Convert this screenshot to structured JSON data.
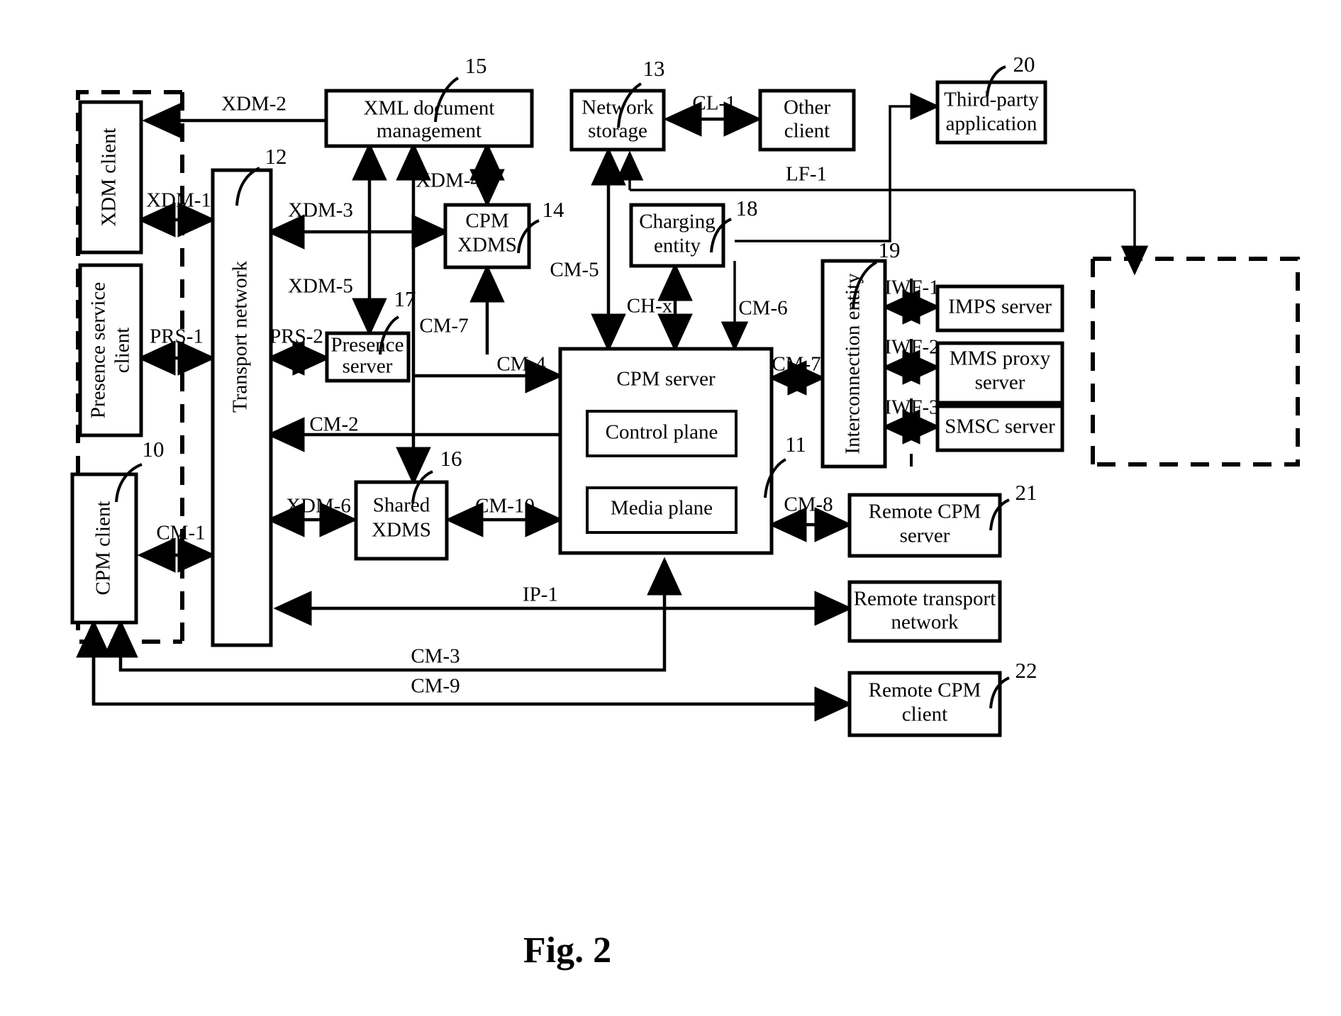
{
  "figure": {
    "caption": "Fig. 2"
  },
  "boxes": [
    {
      "id": "xdm-client",
      "label": "XDM client",
      "orientation": "vertical"
    },
    {
      "id": "presence-service-client",
      "label": "Presence service client",
      "orientation": "vertical"
    },
    {
      "id": "cpm-client",
      "label": "CPM client",
      "orientation": "vertical"
    },
    {
      "id": "transport-network",
      "label": "Transport network",
      "orientation": "vertical"
    },
    {
      "id": "xml-document-management",
      "label": "XML document management",
      "orientation": "horizontal"
    },
    {
      "id": "cpm-xdms",
      "label": "CPM XDMS",
      "orientation": "horizontal"
    },
    {
      "id": "presence-server",
      "label": "Presence server",
      "orientation": "horizontal"
    },
    {
      "id": "shared-xdms",
      "label": "Shared XDMS",
      "orientation": "horizontal"
    },
    {
      "id": "network-storage",
      "label": "Network storage",
      "orientation": "horizontal"
    },
    {
      "id": "other-client",
      "label": "Other client",
      "orientation": "horizontal"
    },
    {
      "id": "third-party-application",
      "label": "Third-party application",
      "orientation": "horizontal"
    },
    {
      "id": "charging-entity",
      "label": "Charging entity",
      "orientation": "horizontal"
    },
    {
      "id": "cpm-server",
      "label": "CPM server",
      "orientation": "horizontal"
    },
    {
      "id": "control-plane",
      "label": "Control plane",
      "orientation": "horizontal"
    },
    {
      "id": "media-plane",
      "label": "Media plane",
      "orientation": "horizontal"
    },
    {
      "id": "interconnection-entity",
      "label": "Interconnection entity",
      "orientation": "vertical"
    },
    {
      "id": "imps-server",
      "label": "IMPS server",
      "orientation": "horizontal"
    },
    {
      "id": "mms-proxy-server",
      "label": "MMS proxy server",
      "orientation": "horizontal"
    },
    {
      "id": "smsc-server",
      "label": "SMSC server",
      "orientation": "horizontal"
    },
    {
      "id": "remote-cpm-server",
      "label": "Remote CPM server",
      "orientation": "horizontal"
    },
    {
      "id": "remote-transport-network",
      "label": "Remote transport network",
      "orientation": "horizontal"
    },
    {
      "id": "remote-cpm-client",
      "label": "Remote CPM client",
      "orientation": "horizontal"
    }
  ],
  "box_labels": {
    "xdm_client": "XDM client",
    "presence_service_client_line1": "Presence service",
    "presence_service_client_line2": "client",
    "cpm_client": "CPM client",
    "transport_network": "Transport network",
    "xml_document_management_line1": "XML document",
    "xml_document_management_line2": "management",
    "cpm_xdms_line1": "CPM",
    "cpm_xdms_line2": "XDMS",
    "presence_server_line1": "Presence",
    "presence_server_line2": "server",
    "shared_xdms_line1": "Shared",
    "shared_xdms_line2": "XDMS",
    "network_storage_line1": "Network",
    "network_storage_line2": "storage",
    "other_client_line1": "Other",
    "other_client_line2": "client",
    "third_party_application_line1": "Third-party",
    "third_party_application_line2": "application",
    "charging_entity_line1": "Charging",
    "charging_entity_line2": "entity",
    "cpm_server": "CPM server",
    "control_plane": "Control plane",
    "media_plane": "Media plane",
    "interconnection_entity": "Interconnection entity",
    "imps_server": "IMPS server",
    "mms_proxy_server_line1": "MMS proxy",
    "mms_proxy_server_line2": "server",
    "smsc_server": "SMSC server",
    "remote_cpm_server_line1": "Remote CPM",
    "remote_cpm_server_line2": "server",
    "remote_transport_network_line1": "Remote transport",
    "remote_transport_network_line2": "network",
    "remote_cpm_client_line1": "Remote CPM",
    "remote_cpm_client_line2": "client"
  },
  "interfaces": {
    "xdm_1": "XDM-1",
    "xdm_2": "XDM-2",
    "xdm_3": "XDM-3",
    "xdm_4": "XDM-4",
    "xdm_5": "XDM-5",
    "xdm_6": "XDM-6",
    "prs_1": "PRS-1",
    "prs_2": "PRS-2",
    "cm_1": "CM-1",
    "cm_2": "CM-2",
    "cm_3": "CM-3",
    "cm_4": "CM-4",
    "cm_5": "CM-5",
    "cm_6": "CM-6",
    "cm_7_left": "CM-7",
    "cm_7_right": "CM-7",
    "cm_8": "CM-8",
    "cm_9": "CM-9",
    "cm_10": "CM-10",
    "ch_x": "CH-x",
    "cl_1": "CL-1",
    "lf_1": "LF-1",
    "ip_1": "IP-1",
    "iwf_1": "IWF-1",
    "iwf_2": "IWF-2",
    "iwf_3": "IWF-3"
  },
  "reference_numerals": {
    "n10": "10",
    "n11": "11",
    "n12": "12",
    "n13": "13",
    "n14": "14",
    "n15": "15",
    "n16": "16",
    "n17": "17",
    "n18": "18",
    "n19": "19",
    "n20": "20",
    "n21": "21",
    "n22": "22"
  },
  "colors": {
    "line": "#000000",
    "fill": "#ffffff"
  }
}
